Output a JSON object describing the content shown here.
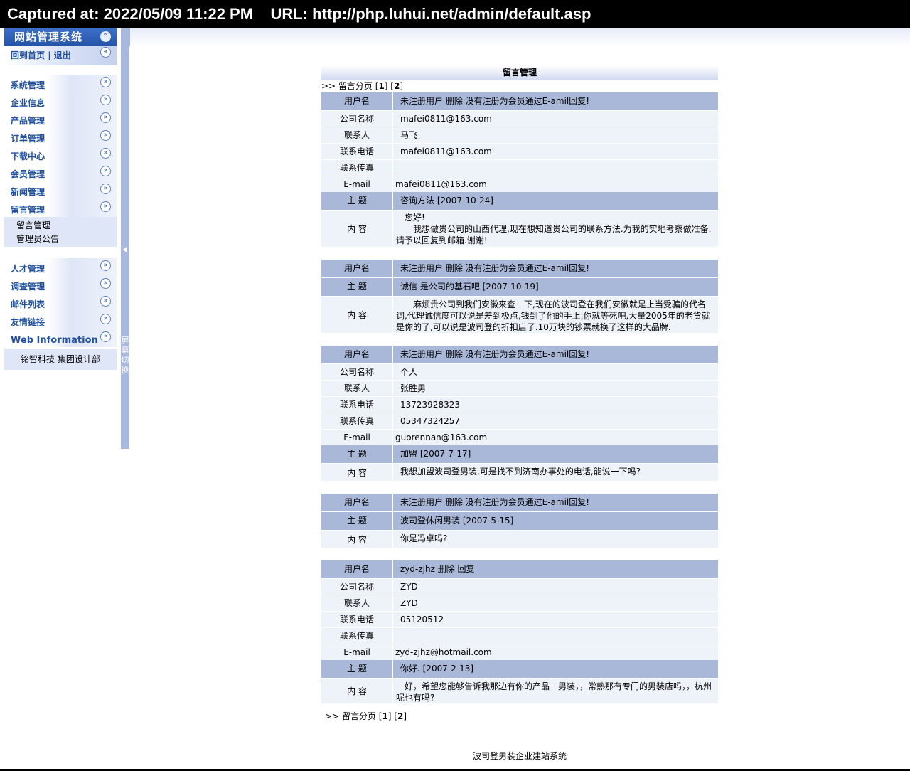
{
  "capture_bar": "Captured at: 2022/05/09 11:22 PM    URL: http://php.luhui.net/admin/default.asp",
  "sidebar": {
    "title": "网站管理系统",
    "home_link": "回到首页",
    "separator": " | ",
    "logout_link": "退出",
    "menu_group1": [
      {
        "label": "系统管理"
      },
      {
        "label": "企业信息"
      },
      {
        "label": "产品管理"
      },
      {
        "label": "订单管理"
      },
      {
        "label": "下载中心"
      },
      {
        "label": "会员管理"
      },
      {
        "label": "新闻管理"
      },
      {
        "label": "留言管理"
      }
    ],
    "submenu": [
      "留言管理",
      "管理员公告"
    ],
    "menu_group2": [
      {
        "label": "人才管理"
      },
      {
        "label": "调查管理"
      },
      {
        "label": "邮件列表"
      },
      {
        "label": "友情链接"
      }
    ],
    "web_info_label": "Web Information",
    "web_info_text": "铭智科技 集团设计部"
  },
  "splitter_text": "屏幕切换",
  "main": {
    "title": "留言管理",
    "pager_prefix": ">> 留言分页 ",
    "pages": [
      "1",
      "2"
    ],
    "labels": {
      "username": "用户名",
      "company": "公司名称",
      "contact": "联系人",
      "phone": "联系电话",
      "fax": "联系传真",
      "email": "E-mail",
      "subject": "主 题",
      "content": "内 容"
    },
    "messages": [
      {
        "user_line": "未注册用户   删除     没有注册为会员通过E-amil回复!",
        "company": "mafei0811@163.com",
        "contact": "马飞",
        "phone": "mafei0811@163.com",
        "fax": "",
        "email": "mafei0811@163.com",
        "subject": "咨询方法  [2007-10-24]",
        "content": "　您好!\n　　我想做贵公司的山西代理,现在想知道贵公司的联系方法.为我的实地考察做准备.请予以回复到邮箱.谢谢!"
      },
      {
        "user_line": "未注册用户   删除     没有注册为会员通过E-amil回复!",
        "subject": " 诚信 是公司的基石吧  [2007-10-19]",
        "content": "　　麻烦贵公司到我们安徽来查一下,现在的波司登在我们安徽就是上当受骗的代名词,代理诚信度可以说是差到极点,钱到了他的手上,你就等死吧,大量2005年的老货就是你的了,可以说是波司登的折扣店了.10万块的钞票就换了这样的大品牌."
      },
      {
        "user_line": "未注册用户   删除     没有注册为会员通过E-amil回复!",
        "company": "个人",
        "contact": "张胜男",
        "phone": "13723928323",
        "fax": "05347324257",
        "email": "guorennan@163.com",
        "subject": "加盟  [2007-7-17]",
        "content": "我想加盟波司登男装,可是找不到济南办事处的电话,能说一下吗?"
      },
      {
        "user_line": "未注册用户   删除     没有注册为会员通过E-amil回复!",
        "subject": "波司登休闲男装  [2007-5-15]",
        "content": "你是冯卓吗?"
      },
      {
        "user_line": "zyd-zjhz   删除     回复",
        "company": "ZYD",
        "contact": "ZYD",
        "phone": "05120512",
        "fax": "",
        "email": "zyd-zjhz@hotmail.com",
        "subject": "你好.  [2007-2-13]",
        "content": "　好，希望您能够告诉我那边有你的产品－男装，，常熟那有专门的男装店吗，，杭州呢也有吗?"
      }
    ]
  },
  "footer": "波司登男装企业建站系统"
}
